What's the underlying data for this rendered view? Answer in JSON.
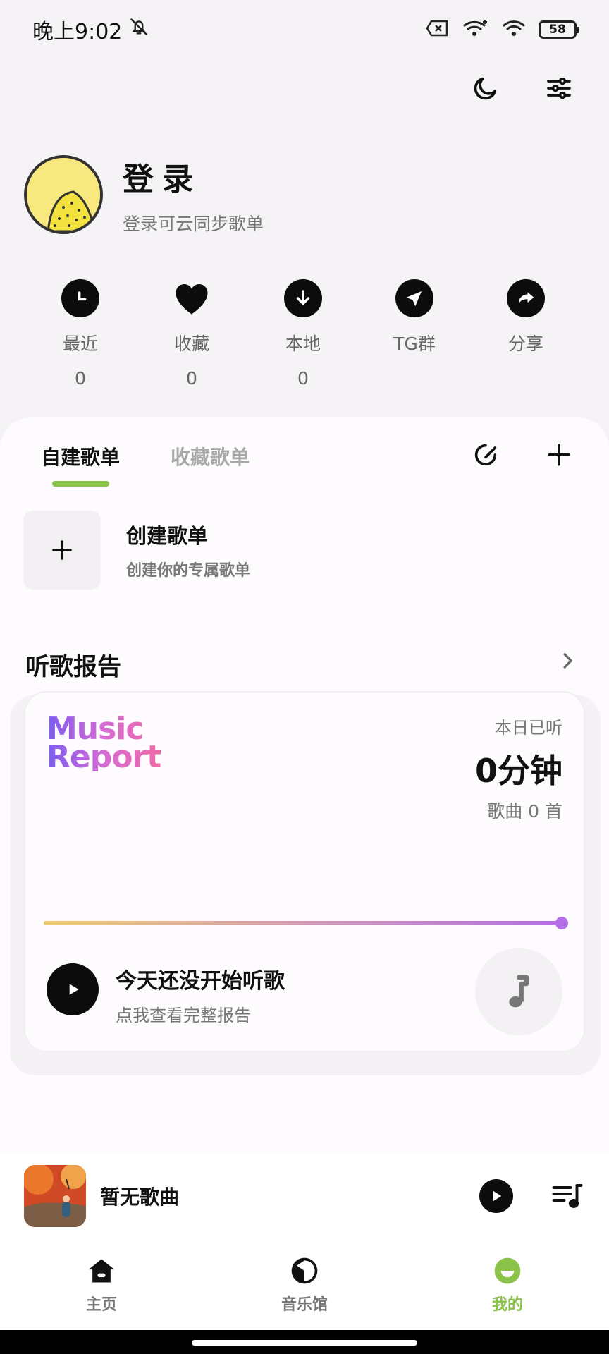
{
  "status": {
    "time": "晚上9:02",
    "battery": "58"
  },
  "profile": {
    "name": "登录",
    "subtitle": "登录可云同步歌单"
  },
  "quick": [
    {
      "label": "最近",
      "count": "0",
      "icon": "clock-icon"
    },
    {
      "label": "收藏",
      "count": "0",
      "icon": "heart-icon"
    },
    {
      "label": "本地",
      "count": "0",
      "icon": "download-icon"
    },
    {
      "label": "TG群",
      "count": "",
      "icon": "telegram-icon"
    },
    {
      "label": "分享",
      "count": "",
      "icon": "share-icon"
    }
  ],
  "tabs": {
    "items": [
      "自建歌单",
      "收藏歌单"
    ],
    "active": 0
  },
  "create": {
    "title": "创建歌单",
    "subtitle": "创建你的专属歌单"
  },
  "report": {
    "section_title": "听歌报告",
    "logo_line1": "Music",
    "logo_line2": "Report",
    "today_label": "本日已听",
    "today_value": "0分钟",
    "song_count": "歌曲 0 首",
    "message_title": "今天还没开始听歌",
    "message_sub": "点我查看完整报告",
    "progress": 1.0
  },
  "player": {
    "title": "暂无歌曲"
  },
  "nav": {
    "items": [
      "主页",
      "音乐馆",
      "我的"
    ],
    "active": 2
  },
  "colors": {
    "accent": "#8bc34a",
    "gradient_start": "#f0c96b",
    "gradient_end": "#b46ee8"
  }
}
